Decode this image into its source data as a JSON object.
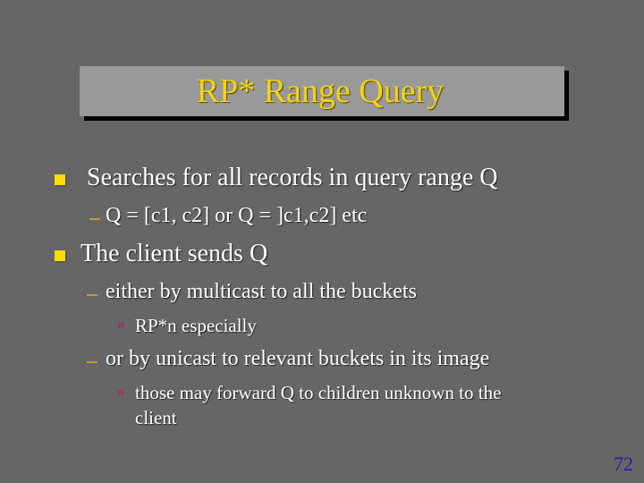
{
  "slide": {
    "title": "RP* Range Query",
    "page_number": "72",
    "colors": {
      "background": "#666666",
      "title_box": "#999999",
      "title_text": "#f2d21b",
      "bullet": "#ffdd00",
      "dash": "#c8963c",
      "chevron": "#b0206a",
      "page_number": "#2a1aa8"
    },
    "bullets": [
      {
        "text": "Searches for all records in query range Q",
        "sub": [
          {
            "text": "Q = [c1, c2] or Q = ]c1,c2] etc"
          }
        ]
      },
      {
        "text": "The client sends Q",
        "sub": [
          {
            "text": "either by multicast to all the buckets",
            "sub": [
              {
                "text": "RP*n especially"
              }
            ]
          },
          {
            "text": "or by unicast to relevant buckets in its image",
            "sub": [
              {
                "text": "those may forward Q to children unknown to the",
                "continuation": "client"
              }
            ]
          }
        ]
      }
    ],
    "icons": {
      "level1": "square-bullet-icon",
      "level2": "dash-bullet-icon",
      "level3": "double-chevron-icon"
    }
  }
}
